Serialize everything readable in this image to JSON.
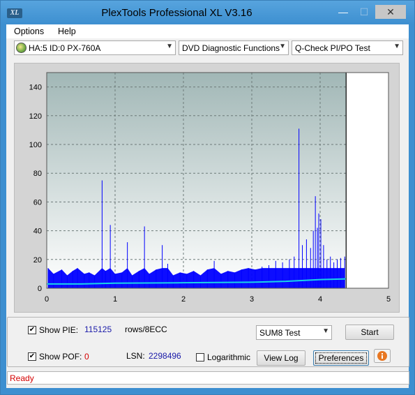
{
  "window": {
    "title": "PlexTools Professional XL V3.16",
    "icon_text": "XL"
  },
  "controls": {
    "min_symbol": "—",
    "max_symbol": "☐",
    "close_symbol": "✕"
  },
  "menu": {
    "items": [
      "Options",
      "Help"
    ]
  },
  "toolbar": {
    "drive": "HA:5 ID:0  PX-760A",
    "function": "DVD Diagnostic Functions",
    "test": "Q-Check PI/PO Test",
    "arrow": "▼"
  },
  "chart_data": {
    "type": "bar",
    "xlim": [
      0,
      5
    ],
    "ylim": [
      0,
      150
    ],
    "xticks": [
      "0",
      "1",
      "2",
      "3",
      "4",
      "5"
    ],
    "yticks": [
      "0",
      "20",
      "40",
      "60",
      "80",
      "100",
      "120",
      "140"
    ],
    "grid": true,
    "end_marker_x": 4.38,
    "background_top": "#a1b7b6",
    "background_bottom": "#ffffff",
    "bar_color": "#0000ff",
    "line_color": "#19d4e6",
    "series": [
      {
        "name": "PIE",
        "points": [
          [
            0.02,
            14
          ],
          [
            0.1,
            10
          ],
          [
            0.22,
            13
          ],
          [
            0.3,
            9
          ],
          [
            0.38,
            12
          ],
          [
            0.45,
            14
          ],
          [
            0.55,
            10
          ],
          [
            0.62,
            11
          ],
          [
            0.7,
            9
          ],
          [
            0.81,
            75
          ],
          [
            0.86,
            12
          ],
          [
            0.93,
            44
          ],
          [
            1.0,
            10
          ],
          [
            1.1,
            11
          ],
          [
            1.18,
            32
          ],
          [
            1.25,
            9
          ],
          [
            1.35,
            12
          ],
          [
            1.43,
            43
          ],
          [
            1.5,
            10
          ],
          [
            1.6,
            13
          ],
          [
            1.69,
            30
          ],
          [
            1.77,
            17
          ],
          [
            1.85,
            9
          ],
          [
            1.95,
            11
          ],
          [
            2.05,
            10
          ],
          [
            2.15,
            12
          ],
          [
            2.25,
            9
          ],
          [
            2.35,
            13
          ],
          [
            2.45,
            19
          ],
          [
            2.55,
            10
          ],
          [
            2.65,
            12
          ],
          [
            2.75,
            11
          ],
          [
            2.85,
            13
          ],
          [
            2.95,
            14
          ],
          [
            3.05,
            13
          ],
          [
            3.15,
            15
          ],
          [
            3.25,
            16
          ],
          [
            3.35,
            19
          ],
          [
            3.45,
            18
          ],
          [
            3.55,
            20
          ],
          [
            3.62,
            22
          ],
          [
            3.69,
            111
          ],
          [
            3.74,
            30
          ],
          [
            3.8,
            34
          ],
          [
            3.86,
            28
          ],
          [
            3.9,
            40
          ],
          [
            3.93,
            64
          ],
          [
            3.96,
            42
          ],
          [
            3.98,
            52
          ],
          [
            4.01,
            48
          ],
          [
            4.05,
            30
          ],
          [
            4.1,
            20
          ],
          [
            4.15,
            22
          ],
          [
            4.2,
            18
          ],
          [
            4.25,
            20
          ],
          [
            4.3,
            21
          ],
          [
            4.36,
            22
          ]
        ]
      }
    ],
    "trend": [
      [
        0.0,
        3
      ],
      [
        0.5,
        3
      ],
      [
        1.0,
        3.5
      ],
      [
        2.0,
        3.8
      ],
      [
        3.0,
        4.2
      ],
      [
        3.5,
        4.8
      ],
      [
        4.0,
        6
      ],
      [
        4.38,
        6.5
      ]
    ]
  },
  "panel": {
    "show_pie_label": "Show PIE:",
    "pie_value": "115125",
    "rows_unit": "rows/8ECC",
    "show_pof_label": "Show POF:",
    "pof_value": "0",
    "lsn_label": "LSN:",
    "lsn_value": "2298496",
    "logarithmic_label": "Logarithmic",
    "sum_select": "SUM8 Test",
    "start_button": "Start",
    "viewlog_button": "View Log",
    "preferences_button": "Preferences",
    "checkmark": "✔"
  },
  "status": {
    "text": "Ready"
  }
}
